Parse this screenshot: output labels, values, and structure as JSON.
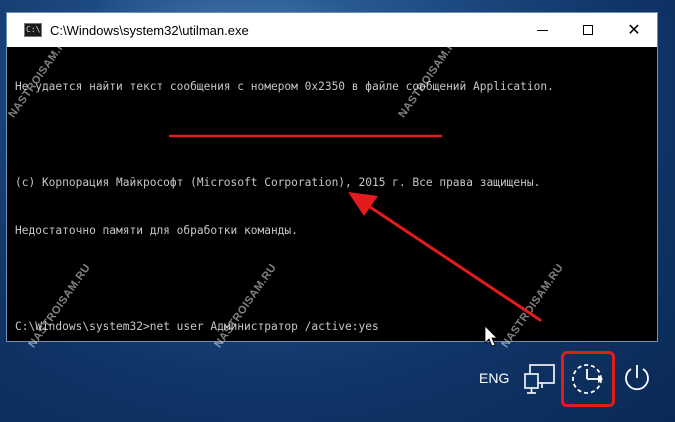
{
  "window": {
    "title": "C:\\Windows\\system32\\utilman.exe",
    "icon_label": "C:\\",
    "minimize_icon": "minimize-icon",
    "maximize_icon": "maximize-icon",
    "close_icon": "close-icon",
    "close_glyph": "✕"
  },
  "console": {
    "lines": [
      "Не удается найти текст сообщения с номером 0x2350 в файле сообщений Application.",
      "",
      "(c) Корпорация Майкрософт (Microsoft Corporation), 2015 г. Все права защищены.",
      "Недостаточно памяти для обработки команды.",
      "",
      "C:\\Windows\\system32>net user Администратор /active:yes"
    ],
    "prompt": "C:\\Windows\\system32>",
    "command": "net user Администратор /active:yes"
  },
  "tray": {
    "language": "ENG",
    "network_icon": "network-icon",
    "accessibility_icon": "ease-of-access-icon",
    "power_icon": "power-icon"
  },
  "watermark": {
    "text": "NASTROISAM.RU"
  },
  "colors": {
    "annotation_red": "#e21c1c",
    "console_text": "#c6c6c6",
    "console_bg": "#000000",
    "desktop_bg": "#1d4a82"
  }
}
